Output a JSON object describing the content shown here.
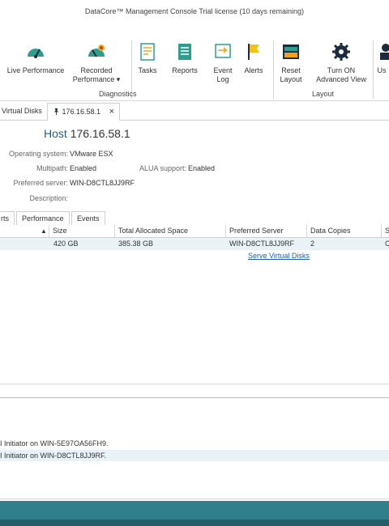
{
  "window": {
    "title": "DataCore™ Management Console   Trial license (10 days remaining)"
  },
  "ribbon": {
    "buttons": [
      {
        "label": "Live Performance",
        "icon": "live-performance-icon"
      },
      {
        "label": "Recorded Performance ▾",
        "icon": "recorded-performance-icon"
      },
      {
        "label": "Tasks",
        "icon": "tasks-icon"
      },
      {
        "label": "Reports",
        "icon": "reports-icon"
      },
      {
        "label": "Event Log",
        "icon": "event-log-icon"
      },
      {
        "label": "Alerts",
        "icon": "alerts-icon"
      },
      {
        "label": "Reset Layout",
        "icon": "reset-layout-icon"
      },
      {
        "label": "Turn ON Advanced View",
        "icon": "gear-icon"
      },
      {
        "label": "Us",
        "icon": "user-icon"
      }
    ],
    "groups": {
      "diagnostics": "Diagnostics",
      "layout": "Layout"
    }
  },
  "tabs": [
    {
      "label": "Virtual Disks"
    },
    {
      "label": "176.16.58.1",
      "close": "×"
    }
  ],
  "host": {
    "prefix": "Host",
    "name": "176.16.58.1",
    "fields": {
      "os_label": "Operating system:",
      "os_value": "VMware ESX",
      "multipath_label": "Multipath:",
      "multipath_value": "Enabled",
      "alua_label": "ALUA support:",
      "alua_value": "Enabled",
      "pref_label": "Preferred server:",
      "pref_value": "WIN-D8CTL8JJ9RF",
      "desc_label": "Description:",
      "desc_value": ""
    }
  },
  "subtabs": [
    "rts",
    "Performance",
    "Events"
  ],
  "grid": {
    "headers": [
      "Size",
      "Total Allocated Space",
      "Preferred Server",
      "Data Copies",
      "St"
    ],
    "row": [
      "420 GB",
      "385.38 GB",
      "WIN-D8CTL8JJ9RF",
      "2",
      "C"
    ],
    "link": "Serve Virtual Disks"
  },
  "log": [
    "I Initiator on WIN-5E97OA56FH9.",
    "I Initiator on WIN-D8CTL8JJ9RF."
  ],
  "colors": {
    "accent": "#2f7f8c",
    "selected_row": "#e9f3f6"
  }
}
